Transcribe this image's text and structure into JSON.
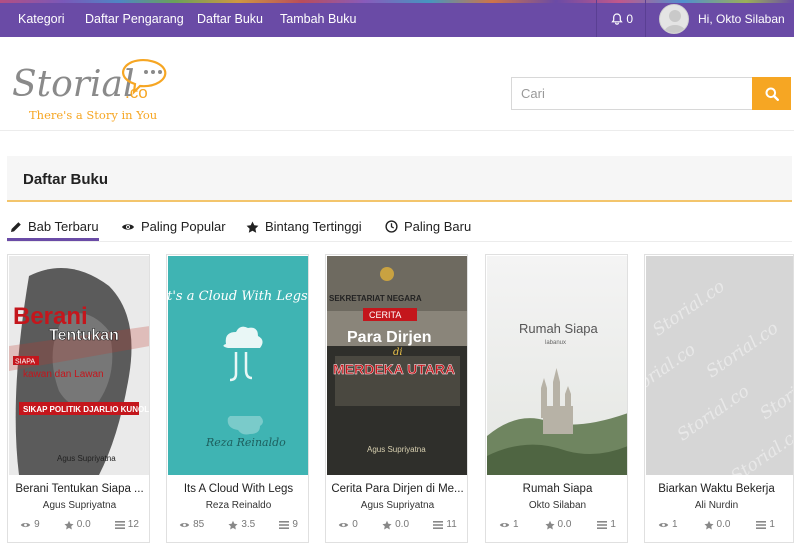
{
  "nav": {
    "items": [
      "Kategori",
      "Daftar Pengarang",
      "Daftar Buku",
      "Tambah Buku"
    ],
    "notifications": "0",
    "greeting": "Hi, Okto Silaban"
  },
  "logo": {
    "name": "Storial",
    "suffix": ".co",
    "tagline": "There's a Story in You"
  },
  "search": {
    "placeholder": "Cari"
  },
  "panel": {
    "title": "Daftar Buku"
  },
  "tabs": [
    {
      "label": "Bab Terbaru",
      "icon": "pencil-icon",
      "active": true
    },
    {
      "label": "Paling Popular",
      "icon": "eye-icon",
      "active": false
    },
    {
      "label": "Bintang Tertinggi",
      "icon": "star-icon",
      "active": false
    },
    {
      "label": "Paling Baru",
      "icon": "clock-icon",
      "active": false
    }
  ],
  "books": [
    {
      "title": "Berani Tentukan Siapa ...",
      "author": "Agus Supriyatna",
      "views": "9",
      "rating": "0.0",
      "chapters": "12",
      "cover": {
        "line1": "Berani",
        "line2": "Tentukan",
        "badge": "SIAPA",
        "line3": "kawan dan Lawan",
        "line4": "SIKAP POLITIK DJARLIO KUNOLO",
        "author": "Agus Supriyatna"
      }
    },
    {
      "title": "Its A Cloud With Legs",
      "author": "Reza Reinaldo",
      "views": "85",
      "rating": "3.5",
      "chapters": "9",
      "cover": {
        "heading": "It's a Cloud With Legs",
        "sign": "Reza Reinaldo"
      }
    },
    {
      "title": "Cerita Para Dirjen di Me...",
      "author": "Agus Supriyatna",
      "views": "0",
      "rating": "0.0",
      "chapters": "11",
      "cover": {
        "top": "SEKRETARIAT NEGARA",
        "badge": "CERITA",
        "line1": "Para Dirjen",
        "line2": "di",
        "line3": "MERDEKA UTARA",
        "author": "Agus Supriyatna"
      }
    },
    {
      "title": "Rumah Siapa",
      "author": "Okto Silaban",
      "views": "1",
      "rating": "0.0",
      "chapters": "1",
      "cover": {
        "title": "Rumah Siapa",
        "sub": "labanux"
      }
    },
    {
      "title": "Biarkan Waktu Bekerja",
      "author": "Ali Nurdin",
      "views": "1",
      "rating": "0.0",
      "chapters": "1",
      "cover": {
        "watermark": "Storial.co"
      }
    }
  ],
  "colors": {
    "nav": "#6a4ba6",
    "accent": "#f6a623",
    "logoGray": "#8a8a8a"
  }
}
